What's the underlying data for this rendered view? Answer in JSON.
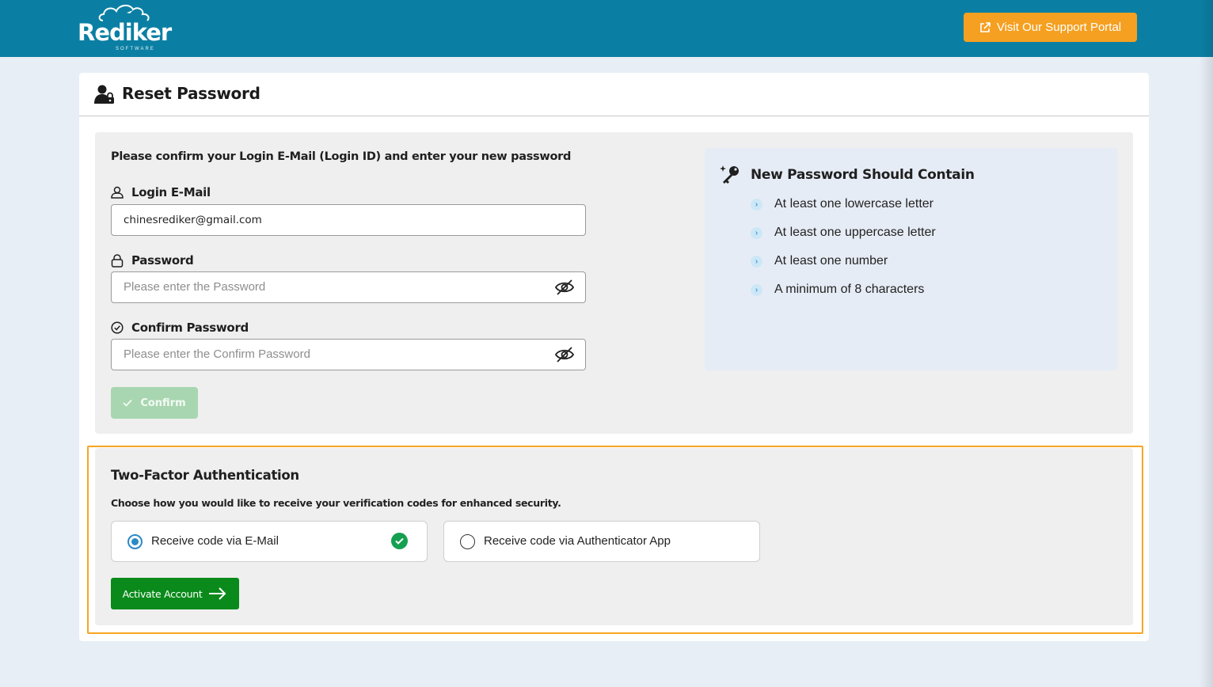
{
  "header": {
    "logo_text": "Rediker",
    "logo_subtext": "SOFTWARE",
    "support_button_label": "Visit Our Support Portal",
    "support_icon": "external-link-icon"
  },
  "page": {
    "title": "Reset Password",
    "title_icon": "user-lock-icon"
  },
  "form": {
    "intro": "Please confirm your Login E-Mail (Login ID) and enter your new password",
    "email": {
      "label": "Login E-Mail",
      "value": "chinesrediker@gmail.com",
      "icon": "user-icon"
    },
    "password": {
      "label": "Password",
      "placeholder": "Please enter the Password",
      "icon": "lock-icon"
    },
    "confirm_password": {
      "label": "Confirm Password",
      "placeholder": "Please enter the Confirm Password",
      "icon": "circle-check-icon"
    },
    "confirm_button": "Confirm",
    "confirm_disabled": true
  },
  "rules": {
    "title": "New Password Should Contain",
    "icon": "magic-key-icon",
    "items": [
      "At least one lowercase letter",
      "At least one uppercase letter",
      "At least one number",
      "A minimum of 8 characters"
    ]
  },
  "two_factor": {
    "title": "Two-Factor Authentication",
    "description": "Choose how you would like to receive your verification codes for enhanced security.",
    "options": [
      {
        "label": "Receive code via E-Mail",
        "selected": true
      },
      {
        "label": "Receive code via Authenticator App",
        "selected": false
      }
    ],
    "activate_button": "Activate Account"
  },
  "colors": {
    "header_bg": "#0b7fa3",
    "support_button": "#f5a021",
    "activate_button": "#0a8a1a",
    "highlight_outline": "#f5a623"
  }
}
